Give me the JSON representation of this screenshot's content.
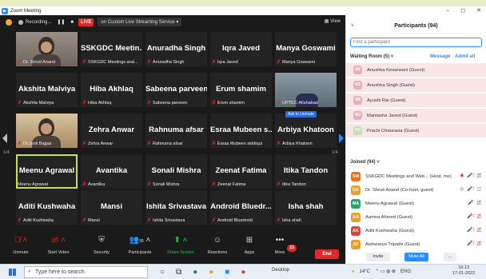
{
  "window": {
    "title": "Zoom Meeting",
    "minimize": "–",
    "maximize": "◻",
    "close": "✕"
  },
  "topbar": {
    "recording": "Recording...",
    "pause": "❚❚",
    "stop": "■",
    "live": "LIVE",
    "live_service": "on Custom Live Streaming Service ▾",
    "view": "▦ View"
  },
  "pager": {
    "left": "1/4",
    "right": "1/4"
  },
  "ask_unmute": "Ask to Unmute",
  "tiles": [
    {
      "name": "",
      "label": "Dr. Shruti Anand",
      "video": true
    },
    {
      "name": "SSKGDC Meetin...",
      "label": "SSKGDC Meetings and..."
    },
    {
      "name": "Anuradha Singh",
      "label": "Anuradha Singh"
    },
    {
      "name": "Iqra Javed",
      "label": "Iqra Javed"
    },
    {
      "name": "Manya Goswami",
      "label": "Manya Goswami"
    },
    {
      "name": "Akshita Malviya",
      "label": "Akshita Malviya"
    },
    {
      "name": "Hiba Akhlaq",
      "label": "Hiba Akhlaq"
    },
    {
      "name": "Sabeena parveen",
      "label": "Sabeena parveen"
    },
    {
      "name": "Erum shamim",
      "label": "Erum shamim"
    },
    {
      "name": "",
      "label": "UPTEC-Allahabad",
      "video": true
    },
    {
      "name": "",
      "label": "Dr.Jyoti Bajpai",
      "video": true
    },
    {
      "name": "Zehra Anwar",
      "label": "Zehra Anwar"
    },
    {
      "name": "Rahnuma afsar",
      "label": "Rahnuma afsar"
    },
    {
      "name": "Esraa Mubeen s...",
      "label": "Esraa Mubeen siddiqui"
    },
    {
      "name": "Arbiya Khatoon",
      "label": "Arbiya Khatoon"
    },
    {
      "name": "Meenu Agrawal",
      "label": "Meenu Agrawal",
      "active": true
    },
    {
      "name": "Avantika",
      "label": "Avantika"
    },
    {
      "name": "Sonali Mishra",
      "label": "Sonali Mishra"
    },
    {
      "name": "Zeenat Fatima",
      "label": "Zeenat Fatima"
    },
    {
      "name": "Itika Tandon",
      "label": "Itika Tandon"
    },
    {
      "name": "Aditi Kushwaha",
      "label": "Aditi Kushwaha"
    },
    {
      "name": "Mansi",
      "label": "Mansi"
    },
    {
      "name": "Ishita Srivastava",
      "label": "Ishita Srivastava"
    },
    {
      "name": "Android Bluedr...",
      "label": "Android Bluedroid"
    },
    {
      "name": "Isha shah",
      "label": "Isha shah"
    }
  ],
  "toolbar": {
    "unmute": "Unmute",
    "start_video": "Start Video",
    "security": "Security",
    "participants": "Participants",
    "participants_count": "99",
    "share_screen": "Share Screen",
    "reactions": "Reactions",
    "apps": "Apps",
    "more": "More",
    "more_badge": "23",
    "end": "End"
  },
  "panel": {
    "title": "Participants (94)",
    "search_placeholder": "Find a participant",
    "waiting_header": "Waiting Room (5)  ˅",
    "message": "Message",
    "admit_all": "Admit all",
    "waiting": [
      {
        "initials": "AK",
        "name": "Anushka Kesarwani (Guest)",
        "color": "#e3b2b5"
      },
      {
        "initials": "AS",
        "name": "Anushka Singh (Guest)",
        "color": "#e3b2b5"
      },
      {
        "initials": "AR",
        "name": "Ayushi Rai (Guest)",
        "color": "#e3b2b5"
      },
      {
        "initials": "MJ",
        "name": "Mantasha Javed (Guest)",
        "color": "#e3b2b5"
      },
      {
        "initials": "PC",
        "name": "Prachi Chaurasia (Guest)",
        "color": "#c6e0b4"
      }
    ],
    "joined_header": "Joined (94)  ˅",
    "joined": [
      {
        "initials": "SM",
        "name": "SSKGDC Meetings and Web... (Host, me)",
        "color": "#e8731c",
        "icons": "◉ 🎤̸ ◫̸",
        "grey": false
      },
      {
        "initials": "DS",
        "name": "Dr. Shruti Anand (Co-host, guest)",
        "color": "#e8a02c",
        "icons": "◎ 🎤̸ ◫",
        "grey": true
      },
      {
        "initials": "MA",
        "name": "Meenu Agrawal (Guest)",
        "color": "#2aa46b",
        "icons": "🎤 ◫̸",
        "grey": false
      },
      {
        "initials": "AA",
        "name": "Aamna Ahmed (Guest)",
        "color": "#e8a02c",
        "icons": "🎤̸ ◫̸",
        "grey": false
      },
      {
        "initials": "AK",
        "name": "Aditi Kushwaha (Guest)",
        "color": "#d44a3a",
        "icons": "🎤̸ ◫̸",
        "grey": false
      },
      {
        "initials": "AT",
        "name": "Aishwarya Tripathi (Guest)",
        "color": "#e8a02c",
        "icons": "🎤̸ ◫̸",
        "grey": false
      }
    ],
    "invite": "Invite",
    "mute_all": "Mute All",
    "more": "..."
  },
  "taskbar": {
    "search": "Type here to search",
    "desktop": "Desktop",
    "weather": "14°C",
    "lang": "ENG",
    "time": "16:13",
    "date": "17-01-2022"
  }
}
